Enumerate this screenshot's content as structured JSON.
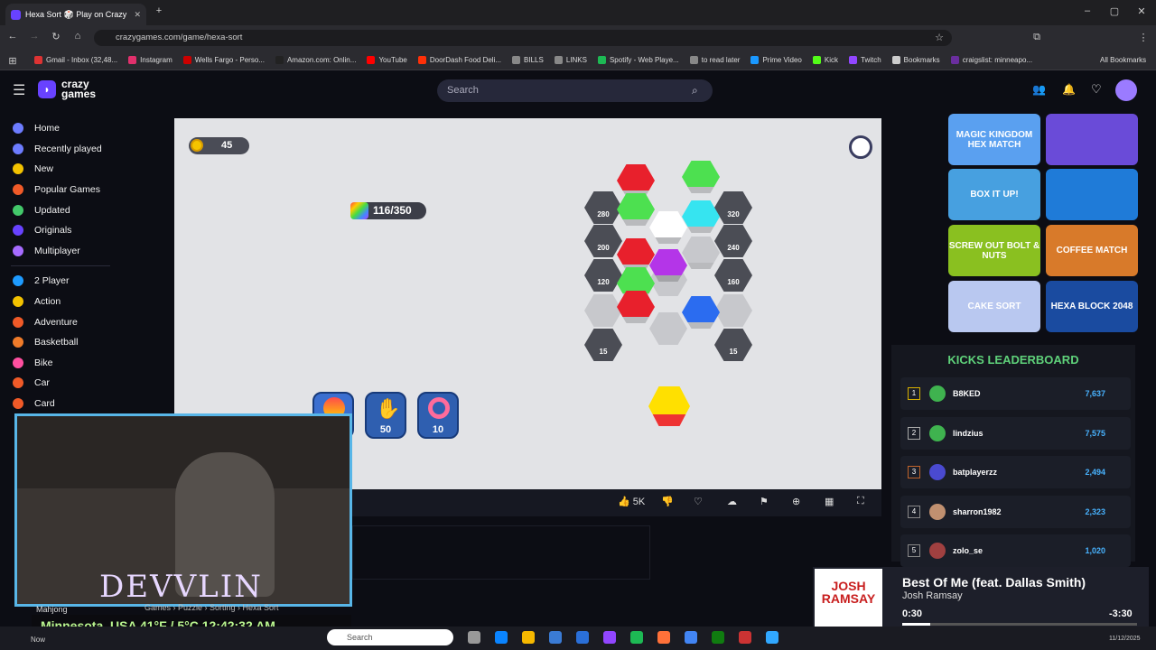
{
  "browser": {
    "tab_title": "Hexa Sort 🎲 Play on Crazy",
    "url": "crazygames.com/game/hexa-sort",
    "bookmarks": [
      "Gmail - Inbox (32,48...",
      "Instagram",
      "Wells Fargo - Perso...",
      "Amazon.com: Onlin...",
      "YouTube",
      "DoorDash Food Deli...",
      "BILLS",
      "LINKS",
      "Spotify - Web Playe...",
      "to read later",
      "Prime Video",
      "Kick",
      "Twitch",
      "Bookmarks",
      "craigslist: minneapo..."
    ],
    "all_bookmarks": "All Bookmarks"
  },
  "site": {
    "logo_line1": "crazy",
    "logo_line2": "games",
    "search_placeholder": "Search"
  },
  "sidebar": {
    "items": [
      "Home",
      "Recently played",
      "New",
      "Popular Games",
      "Updated",
      "Originals",
      "Multiplayer",
      "2 Player",
      "Action",
      "Adventure",
      "Basketball",
      "Bike",
      "Car",
      "Card"
    ],
    "colors": [
      "#6d7cff",
      "#6d7cff",
      "#f3c200",
      "#f05a28",
      "#43c86a",
      "#6842ff",
      "#a66bff",
      "#1e9bff",
      "#f3c200",
      "#f05a28",
      "#f07b2a",
      "#ff4fa0",
      "#f05a28",
      "#f05a28"
    ]
  },
  "game": {
    "coins": "45",
    "progress": "116/350",
    "lock_costs": [
      "280",
      "200",
      "120",
      "320",
      "240",
      "160"
    ],
    "coin_costs": [
      "15",
      "15"
    ],
    "booster_costs": [
      "50",
      "10"
    ]
  },
  "toolbar": {
    "likes": "5K"
  },
  "leaderboard": {
    "title": "KICKS LEADERBOARD",
    "rows": [
      {
        "rank": "1",
        "name": "B8KED",
        "score": "7,637"
      },
      {
        "rank": "2",
        "name": "lindzius",
        "score": "7,575"
      },
      {
        "rank": "3",
        "name": "batplayerzz",
        "score": "2,494"
      },
      {
        "rank": "4",
        "name": "sharron1982",
        "score": "2,323"
      },
      {
        "rank": "5",
        "name": "zolo_se",
        "score": "1,020"
      }
    ]
  },
  "thumbs": [
    "MAGIC KINGDOM HEX MATCH",
    "",
    "BOX IT UP!",
    "",
    "SCREW OUT BOLT & NUTS",
    "COFFEE MATCH",
    "CAKE SORT",
    "HEXA BLOCK 2048"
  ],
  "stream": {
    "name": "DEVVLIN",
    "info": "Minnesota, USA  41°F / 5°C  12:42:32 AM",
    "breadcrumb": "Games  ›  Puzzle  ›  Sorting  ›  Hexa Sort",
    "mahjong": "Mahjong"
  },
  "music": {
    "title": "Best Of Me (feat. Dallas Smith)",
    "artist": "Josh Ramsay",
    "elapsed": "0:30",
    "remaining": "-3:30",
    "art_text": "JOSH RAMSAY",
    "progress": 0.12
  },
  "taskbar": {
    "search": "Search",
    "start": "Now",
    "date": "11/12/2025"
  }
}
